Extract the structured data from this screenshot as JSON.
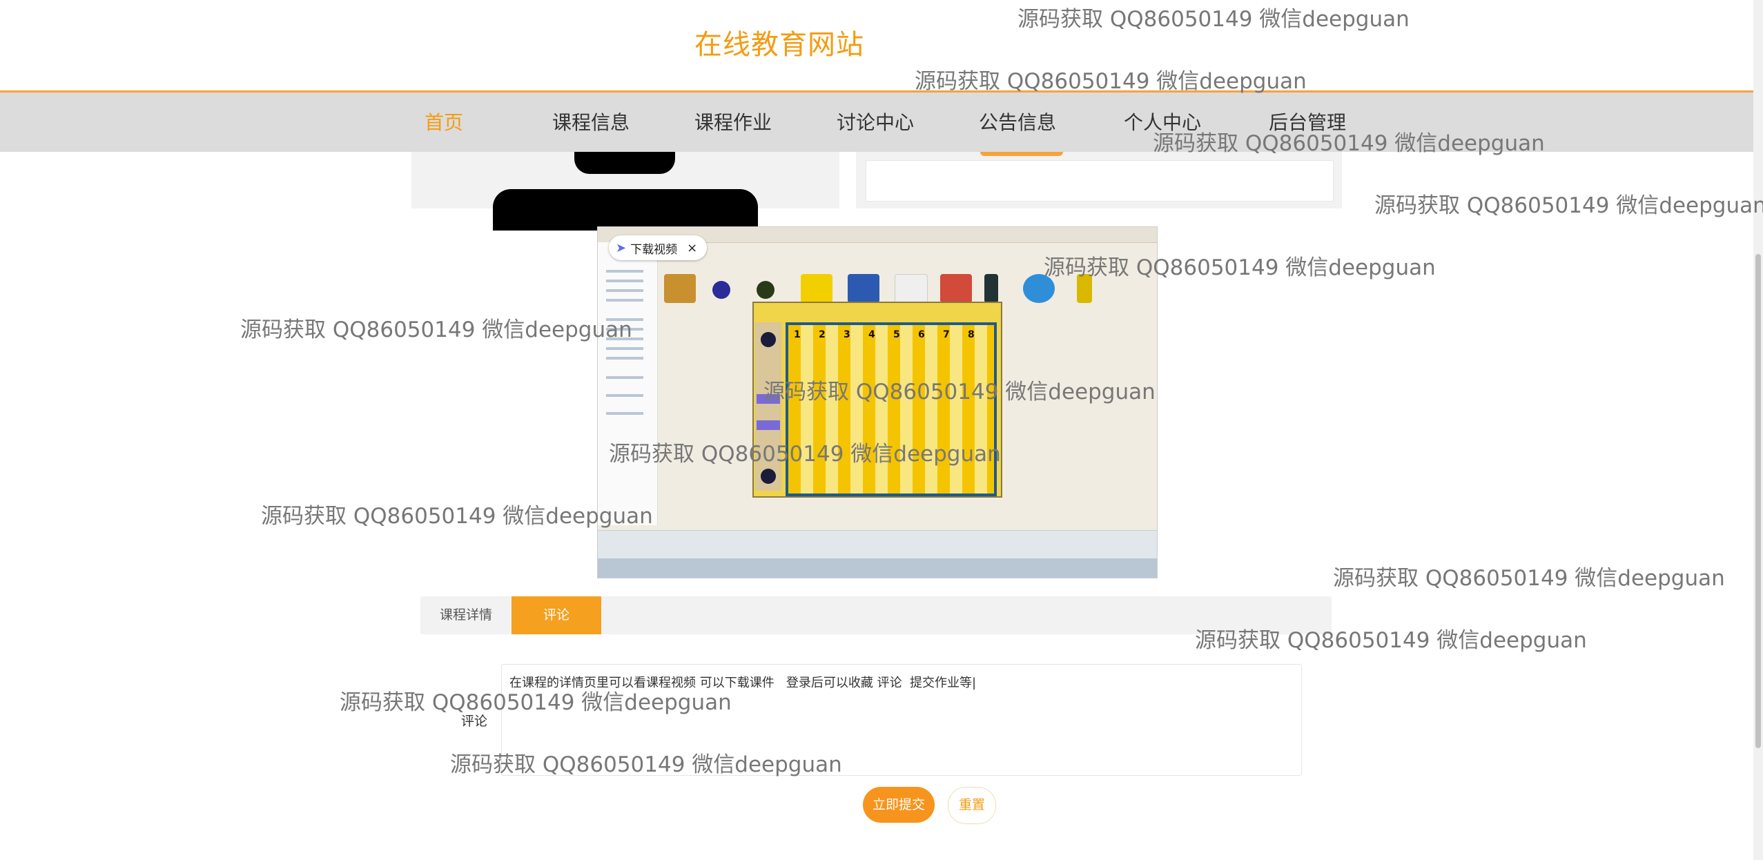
{
  "site": {
    "title": "在线教育网站"
  },
  "nav": {
    "items": [
      {
        "label": "首页",
        "active": true
      },
      {
        "label": "课程信息"
      },
      {
        "label": "课程作业"
      },
      {
        "label": "讨论中心"
      },
      {
        "label": "公告信息"
      },
      {
        "label": "个人中心"
      },
      {
        "label": "后台管理"
      }
    ]
  },
  "video": {
    "download_label": "下载视频",
    "close_symbol": "×",
    "column_numbers": [
      "1",
      "2",
      "3",
      "4",
      "5",
      "6",
      "7",
      "8"
    ]
  },
  "tabs": [
    {
      "label": "课程详情",
      "active": false
    },
    {
      "label": "评论",
      "active": true
    }
  ],
  "comment": {
    "label": "评论",
    "value": "在课程的详情页里可以看课程视频 可以下载课件   登录后可以收藏 评论  提交作业等|",
    "submit_label": "立即提交",
    "reset_label": "重置"
  },
  "watermark": {
    "text": "源码获取 QQ86050149 微信deepguan"
  },
  "colors": {
    "accent": "#f39c12",
    "nav_bg": "#dcdcdc",
    "button": "#f7941d"
  }
}
